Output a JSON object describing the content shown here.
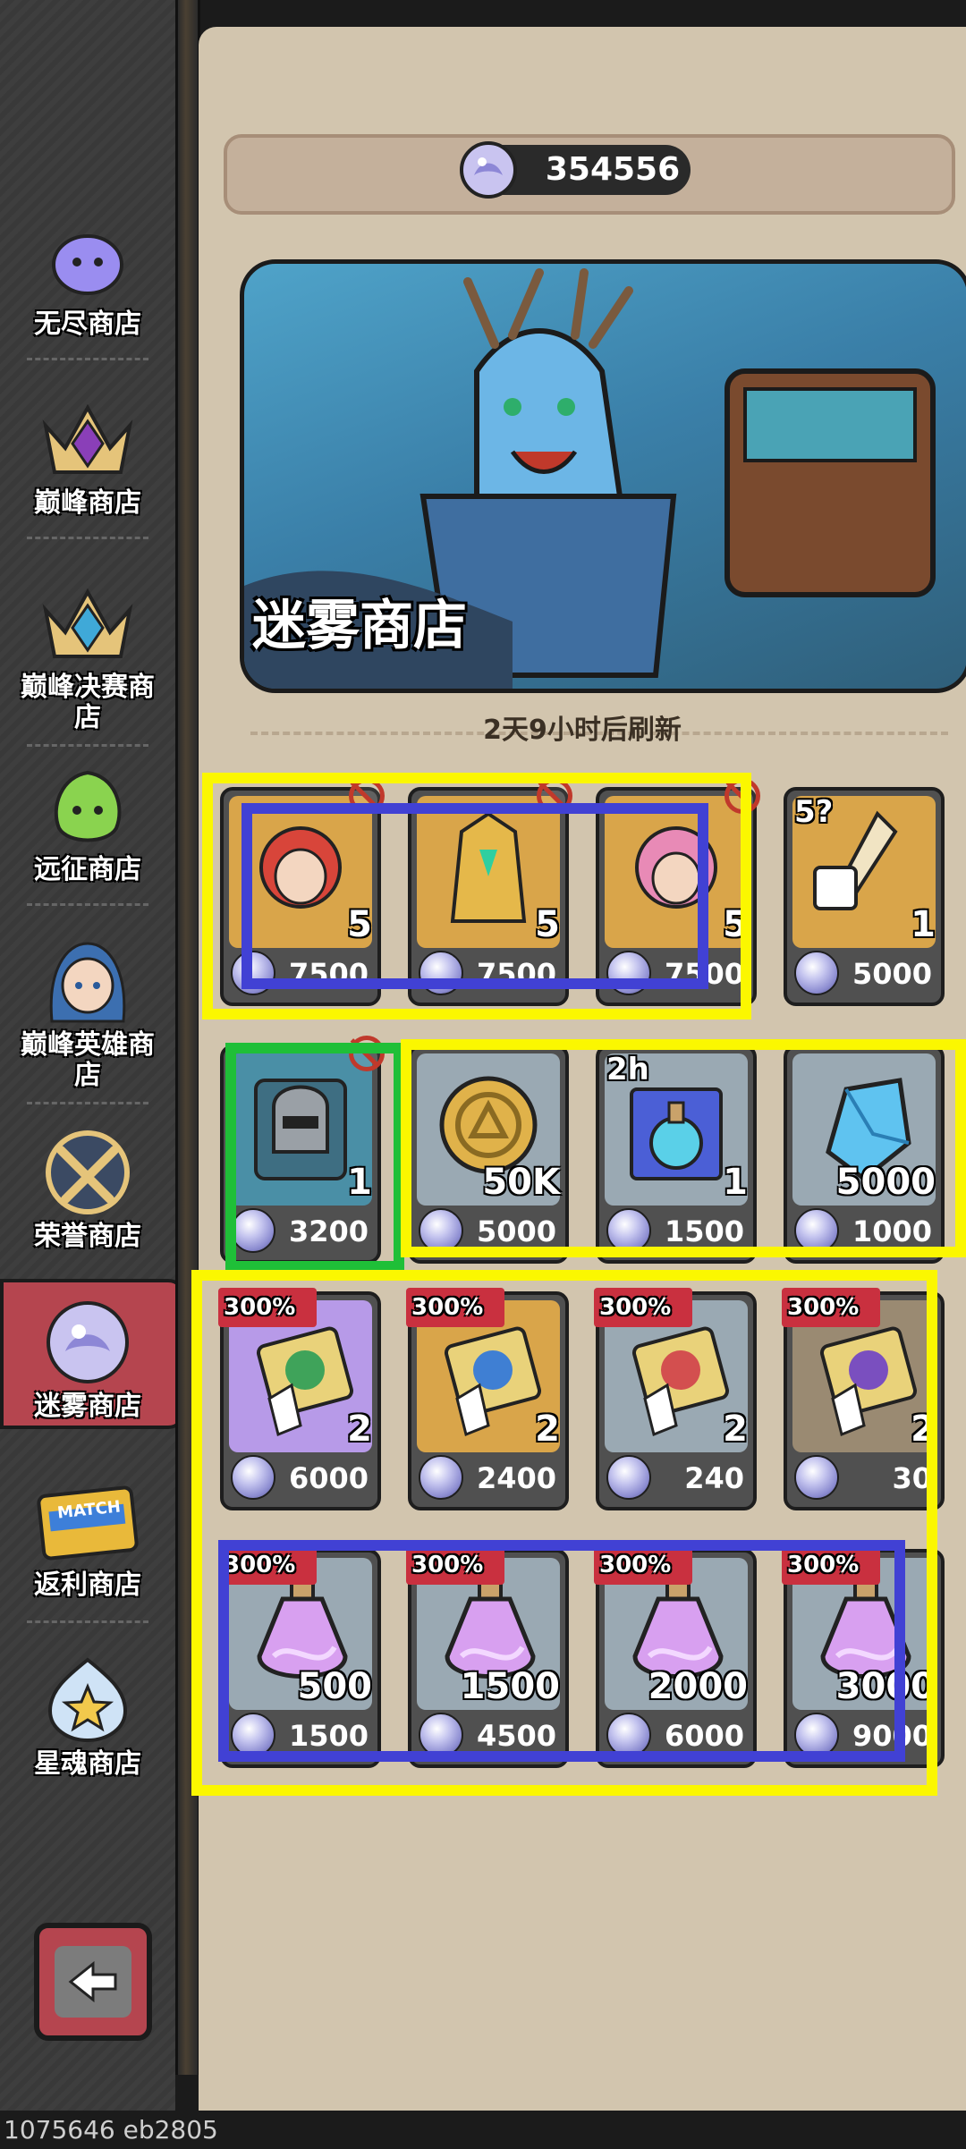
{
  "sidebar": {
    "items": [
      {
        "label": "无尽商店",
        "icon": "slime-icon"
      },
      {
        "label": "巅峰商店",
        "icon": "purple-crown-icon"
      },
      {
        "label": "巅峰决赛商店",
        "icon": "blue-crown-icon"
      },
      {
        "label": "远征商店",
        "icon": "green-slime-icon"
      },
      {
        "label": "巅峰英雄商店",
        "icon": "hero-portrait-icon"
      },
      {
        "label": "荣誉商店",
        "icon": "crossed-swords-icon"
      },
      {
        "label": "迷雾商店",
        "icon": "mist-orb-icon",
        "active": true
      },
      {
        "label": "返利商店",
        "icon": "match-card-icon"
      },
      {
        "label": "星魂商店",
        "icon": "star-gem-icon"
      }
    ],
    "match_text": "MATCH",
    "back_icon": "back-arrow-icon"
  },
  "header": {
    "currency_value": "354556",
    "currency_icon": "mist-orb-icon"
  },
  "banner": {
    "title": "迷雾商店"
  },
  "shop": {
    "refresh_text": "2天9小时后刷新",
    "items": [
      {
        "qty": "5",
        "price": "7500",
        "icon": "hero-shard-red-hair-icon",
        "locked": true
      },
      {
        "qty": "5",
        "price": "7500",
        "icon": "hero-shard-golden-knight-icon",
        "locked": true
      },
      {
        "qty": "5",
        "price": "7500",
        "icon": "hero-shard-pink-hair-icon",
        "locked": true
      },
      {
        "qty": "1",
        "price": "5000",
        "icon": "dice-sword-icon",
        "badge": "5?",
        "locked": false
      },
      {
        "qty": "1",
        "price": "3200",
        "icon": "helmet-book-icon",
        "locked": true
      },
      {
        "qty": "50K",
        "price": "5000",
        "icon": "gold-coin-icon",
        "locked": false
      },
      {
        "qty": "1",
        "price": "1500",
        "icon": "potion-ticket-icon",
        "badge": "2h",
        "locked": false
      },
      {
        "qty": "5000",
        "price": "1000",
        "icon": "blue-crystal-icon",
        "locked": false
      },
      {
        "qty": "2",
        "price": "6000",
        "icon": "skill-book-purple-icon",
        "ribbon": "300%"
      },
      {
        "qty": "2",
        "price": "2400",
        "icon": "skill-book-gold-icon",
        "ribbon": "300%"
      },
      {
        "qty": "2",
        "price": "240",
        "icon": "skill-book-silver-icon",
        "ribbon": "300%"
      },
      {
        "qty": "2",
        "price": "30",
        "icon": "skill-book-brown-icon",
        "ribbon": "300%"
      },
      {
        "qty": "500",
        "price": "1500",
        "icon": "purple-potion-icon",
        "ribbon": "300%"
      },
      {
        "qty": "1500",
        "price": "4500",
        "icon": "purple-potion-icon",
        "ribbon": "300%"
      },
      {
        "qty": "2000",
        "price": "6000",
        "icon": "purple-potion-icon",
        "ribbon": "300%"
      },
      {
        "qty": "3000",
        "price": "9000",
        "icon": "purple-potion-icon",
        "ribbon": "300%"
      }
    ]
  },
  "colors": {
    "panel_bg": "#d2c5ae",
    "sidebar_bg": "#3a3a3a",
    "active_tab": "#b5454f",
    "highlight_yellow": "#fbf700",
    "highlight_blue": "#4141d4",
    "highlight_green": "#1fbf38",
    "ribbon_red": "#c9303f"
  },
  "footer": {
    "build_id": "1075646 eb2805"
  }
}
